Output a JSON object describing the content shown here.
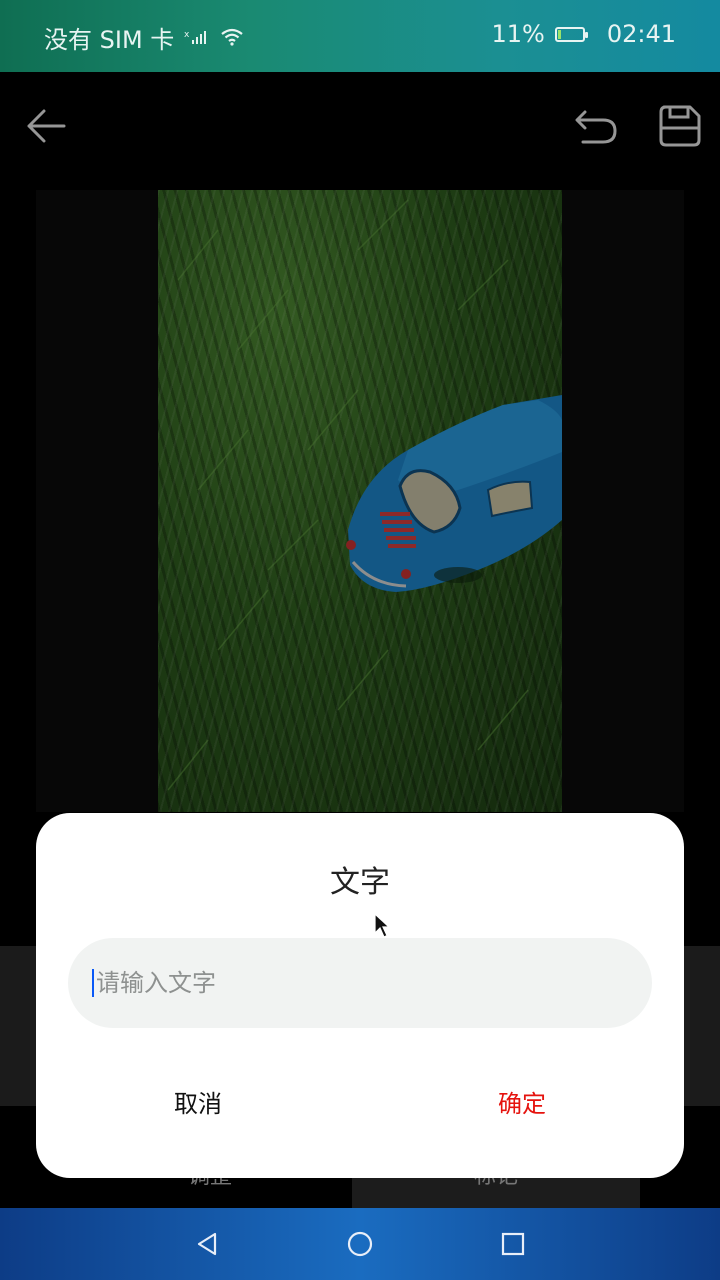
{
  "status_bar": {
    "carrier": "没有 SIM 卡",
    "signal_icon": "no-sim-signal-icon",
    "wifi_icon": "wifi-icon",
    "battery": "11%",
    "time": "02:41"
  },
  "toolbar": {
    "back_icon": "back-arrow-icon",
    "undo_icon": "undo-icon",
    "save_icon": "save-icon"
  },
  "tabs": [
    {
      "label": "调整"
    },
    {
      "label": "标记"
    }
  ],
  "dialog": {
    "title": "文字",
    "input_placeholder": "请输入文字",
    "input_value": "",
    "cancel_label": "取消",
    "confirm_label": "确定"
  },
  "nav": {
    "back_icon": "nav-back-icon",
    "home_icon": "nav-home-icon",
    "recent_icon": "nav-recent-icon"
  },
  "colors": {
    "confirm": "#e5130e",
    "caret": "#0a59f7"
  }
}
